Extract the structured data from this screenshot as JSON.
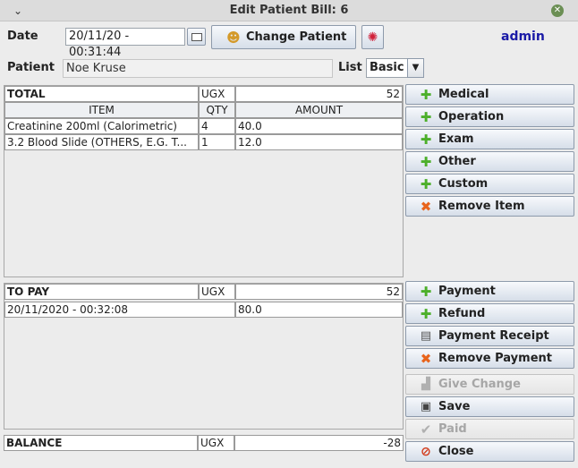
{
  "window": {
    "title": "Edit Patient Bill: 6",
    "minimize_glyph": "⌄",
    "close_glyph": "✕"
  },
  "header": {
    "date_label": "Date",
    "date_value": "20/11/20 - 00:31:44",
    "calendar_icon": "calendar-icon",
    "change_patient_label": "Change Patient",
    "user": "admin",
    "patient_label": "Patient",
    "patient_value": "Noe Kruse",
    "list_label": "List",
    "list_value": "Basic"
  },
  "items_table": {
    "total_label": "TOTAL",
    "currency": "UGX",
    "total_value": "52",
    "columns": [
      "ITEM",
      "QTY",
      "AMOUNT"
    ],
    "rows": [
      {
        "item": "Creatinine 200ml (Calorimetric)",
        "qty": "4",
        "amount": "40.0"
      },
      {
        "item": "3.2 Blood Slide (OTHERS, E.G. T...",
        "qty": "1",
        "amount": "12.0"
      }
    ]
  },
  "payments_table": {
    "to_pay_label": "TO PAY",
    "currency": "UGX",
    "to_pay_value": "52",
    "rows": [
      {
        "date": "20/11/2020 - 00:32:08",
        "amount": "80.0"
      }
    ]
  },
  "balance": {
    "label": "BALANCE",
    "currency": "UGX",
    "value": "-28"
  },
  "buttons": {
    "medical": "Medical",
    "operation": "Operation",
    "exam": "Exam",
    "other": "Other",
    "custom": "Custom",
    "remove_item": "Remove Item",
    "payment": "Payment",
    "refund": "Refund",
    "payment_receipt": "Payment Receipt",
    "remove_payment": "Remove Payment",
    "give_change": "Give Change",
    "save": "Save",
    "paid": "Paid",
    "close": "Close"
  },
  "colors": {
    "user_text": "#1a1aa6",
    "add_icon": "#4caf2a",
    "remove_icon": "#e8641c",
    "close_icon": "#d23a1a"
  }
}
